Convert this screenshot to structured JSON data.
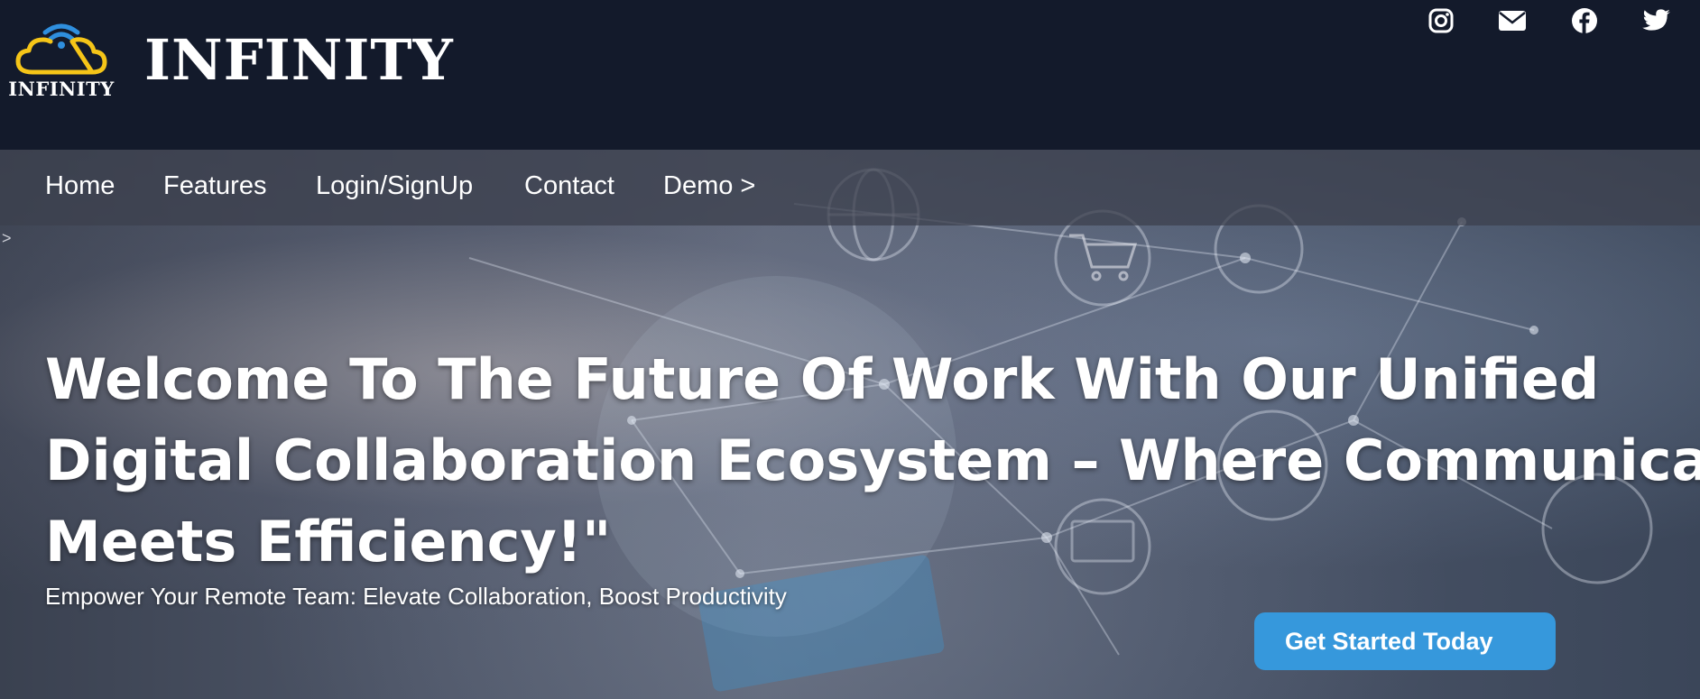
{
  "brand": {
    "logo_text": "INFINITY",
    "name": "INFINITY"
  },
  "social": [
    {
      "icon": "instagram-icon"
    },
    {
      "icon": "envelope-icon"
    },
    {
      "icon": "facebook-icon"
    },
    {
      "icon": "twitter-icon"
    }
  ],
  "nav": {
    "items": [
      "Home",
      "Features",
      "Login/SignUp",
      "Contact",
      "Demo >"
    ]
  },
  "hero": {
    "stray_mark": ">",
    "headline_lines": [
      "Welcome To The Future Of Work With Our Unified",
      "Digital Collaboration Ecosystem – Where Communication",
      "Meets Efficiency!\""
    ],
    "subheadline": "Empower Your Remote Team: Elevate Collaboration, Boost Productivity",
    "cta_label": "Get Started Today"
  },
  "colors": {
    "header_bg": "#131a2b",
    "logo_cloud": "#f5c518",
    "logo_wifi": "#2f8fde",
    "cta_bg": "#3698dc",
    "text": "#ffffff"
  }
}
